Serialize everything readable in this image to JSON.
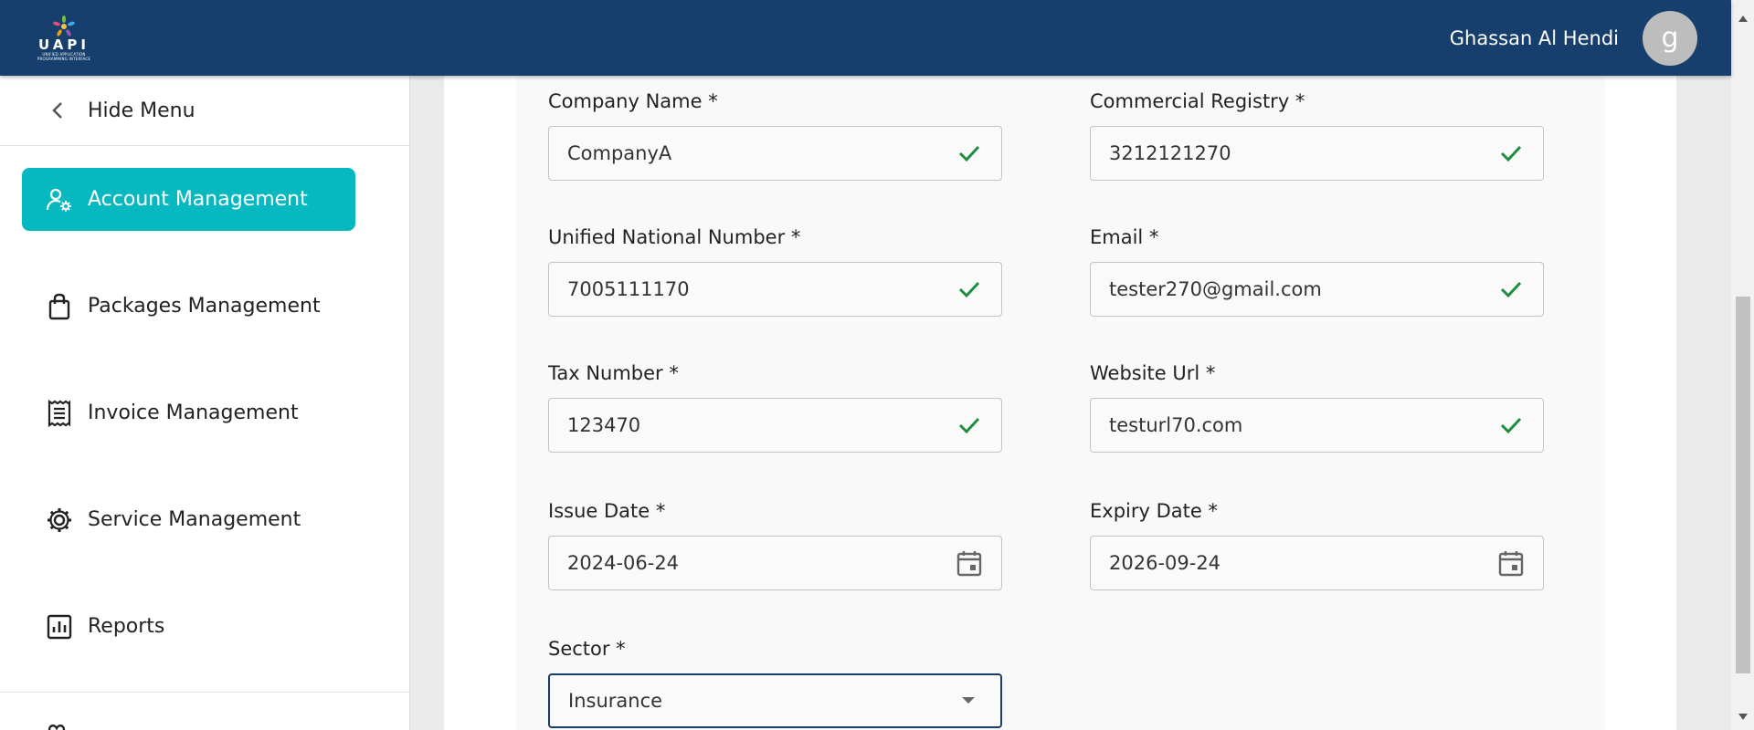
{
  "header": {
    "logo_word": "UAPI",
    "logo_subtitle": "UNIFIED APPLICATION PROGRAMMING INTERFACE",
    "user_name": "Ghassan Al Hendi",
    "avatar_initial": "g"
  },
  "sidebar": {
    "hide_menu_label": "Hide Menu",
    "items": [
      {
        "label": "Account Management",
        "icon": "user-gear-icon",
        "active": true
      },
      {
        "label": "Packages Management",
        "icon": "bag-icon",
        "active": false
      },
      {
        "label": "Invoice Management",
        "icon": "receipt-icon",
        "active": false
      },
      {
        "label": "Service Management",
        "icon": "gear-icon",
        "active": false
      },
      {
        "label": "Reports",
        "icon": "chart-icon",
        "active": false
      }
    ]
  },
  "form": {
    "company_name": {
      "label": "Company Name *",
      "value": "CompanyA",
      "icon": "check-icon"
    },
    "commercial_registry": {
      "label": "Commercial Registry *",
      "value": "3212121270",
      "icon": "check-icon"
    },
    "unified_national_number": {
      "label": "Unified National Number *",
      "value": "7005111170",
      "icon": "check-icon"
    },
    "email": {
      "label": "Email *",
      "value": "tester270@gmail.com",
      "icon": "check-icon"
    },
    "tax_number": {
      "label": "Tax Number *",
      "value": "123470",
      "icon": "check-icon"
    },
    "website_url": {
      "label": "Website Url *",
      "value": "testurl70.com",
      "icon": "check-icon"
    },
    "issue_date": {
      "label": "Issue Date *",
      "value": "2024-06-24",
      "icon": "calendar-icon"
    },
    "expiry_date": {
      "label": "Expiry Date *",
      "value": "2026-09-24",
      "icon": "calendar-icon"
    },
    "sector": {
      "label": "Sector *",
      "value": "Insurance",
      "icon": "dropdown-arrow-icon"
    }
  },
  "colors": {
    "header_bg": "#163f6d",
    "active_nav": "#06b9c1",
    "valid_check": "#1e8e3e"
  }
}
